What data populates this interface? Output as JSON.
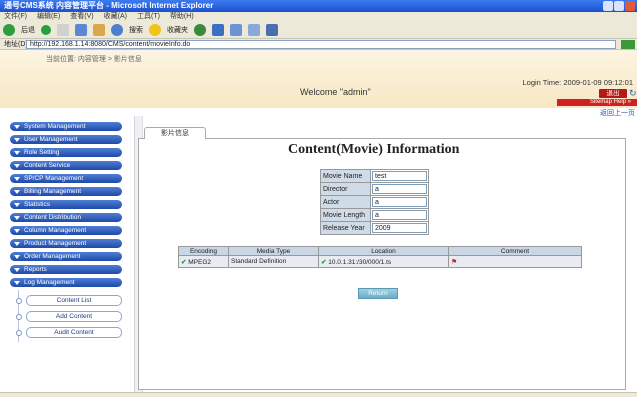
{
  "window": {
    "title": "通号CMS系统 内容管理平台 - Microsoft Internet Explorer"
  },
  "menubar": {
    "items": [
      "文件(F)",
      "编辑(E)",
      "查看(V)",
      "收藏(A)",
      "工具(T)",
      "帮助(H)"
    ]
  },
  "toolbar": {
    "back": "后退",
    "search": "搜索",
    "favorites": "收藏夹"
  },
  "address": {
    "label": "地址(D)",
    "url": "http://192.168.1.14:8080/CMS/content/movieInfo.do"
  },
  "header": {
    "breadcrumb": "当前位置: 内容管理 > 影片信息",
    "login_info": "Login Time: 2009-01-09 09:12:01",
    "welcome": "Welcome \"admin\"",
    "logout": "退出",
    "red_banner": "Sitemap  Help  »",
    "nav_link": "返回上一页"
  },
  "sidebar": {
    "items": [
      "System Management",
      "User Management",
      "Role Setting",
      "Content Service",
      "SP/CP Management",
      "Billing Management",
      "Statistics",
      "Content Distribution",
      "Column Management",
      "Product Management",
      "Order Management",
      "Reports",
      "Log Management"
    ],
    "sub_items": [
      "Content List",
      "Add Content",
      "Audit Content"
    ]
  },
  "main": {
    "tab_label": "影片信息",
    "heading": "Content(Movie) Information",
    "form": [
      {
        "label": "Movie Name",
        "value": "test"
      },
      {
        "label": "Director",
        "value": "a"
      },
      {
        "label": "Actor",
        "value": "a"
      },
      {
        "label": "Movie Length",
        "value": "a"
      },
      {
        "label": "Release Year",
        "value": "2009"
      }
    ],
    "table": {
      "headers": [
        "Encoding",
        "Media Type",
        "Location",
        "Comment"
      ],
      "rows": [
        {
          "encoding": "MPEG2",
          "media_type": "Standard Definition",
          "location": "10.0.1.31:/30/000/1.ts",
          "comment": ""
        }
      ]
    },
    "more_button": "Return"
  }
}
